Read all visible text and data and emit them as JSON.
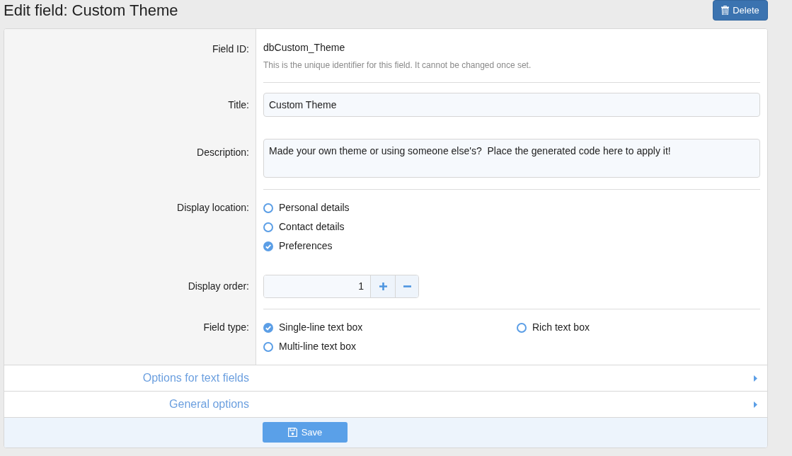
{
  "header": {
    "title": "Edit field: Custom Theme",
    "delete_button": {
      "label": "Delete"
    }
  },
  "form": {
    "sections": [
      {
        "rows": [
          {
            "kind": "static",
            "label": "Field ID:",
            "value": "dbCustom_Theme",
            "hint": "This is the unique identifier for this field. It cannot be changed once set."
          }
        ]
      },
      {
        "rows": [
          {
            "kind": "text_input",
            "label": "Title:",
            "value": "Custom Theme"
          },
          {
            "kind": "textarea",
            "label": "Description:",
            "value": "Made your own theme or using someone else's?  Place the generated code here to apply it!"
          }
        ]
      },
      {
        "rows": [
          {
            "kind": "radio_list",
            "label": "Display location:",
            "options": [
              {
                "label": "Personal details",
                "selected": false
              },
              {
                "label": "Contact details",
                "selected": false
              },
              {
                "label": "Preferences",
                "selected": true
              }
            ]
          },
          {
            "kind": "number",
            "label": "Display order:",
            "value": "1"
          }
        ]
      },
      {
        "rows": [
          {
            "kind": "radio_grid",
            "label": "Field type:",
            "options": [
              {
                "label": "Single-line text box",
                "selected": true
              },
              {
                "label": "Rich text box",
                "selected": false
              },
              {
                "label": "Multi-line text box",
                "selected": false
              }
            ]
          }
        ]
      }
    ],
    "collapsibles": [
      {
        "title": "Options for text fields",
        "expanded": false
      },
      {
        "title": "General options",
        "expanded": false
      }
    ],
    "save_button": {
      "label": "Save"
    }
  }
}
